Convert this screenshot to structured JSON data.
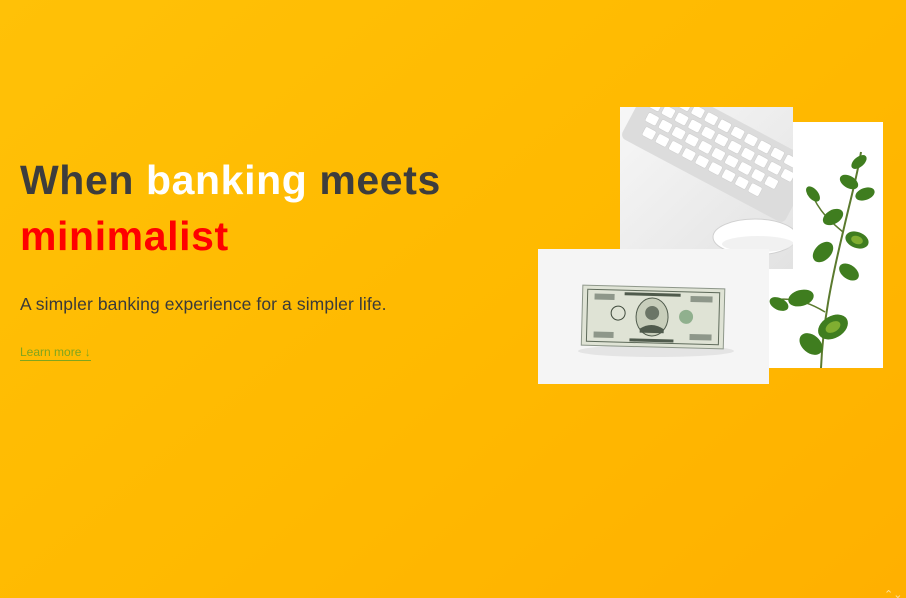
{
  "hero": {
    "headline": {
      "part1": "When ",
      "part2": "banking",
      "part3": " meets",
      "part4": "minimalist"
    },
    "subtitle": "A simpler banking experience for a simpler life.",
    "learn_more": "Learn more ↓"
  },
  "colors": {
    "background": "#ffbd00",
    "headline_dark": "#3d3d3d",
    "headline_accent_white": "#ffffff",
    "headline_accent_red": "#ff0000",
    "link": "#7fa51f"
  },
  "images": {
    "keyboard": "keyboard-and-mouse-photo",
    "plant": "eucalyptus-plant-photo",
    "dollar": "one-dollar-bill-photo"
  }
}
